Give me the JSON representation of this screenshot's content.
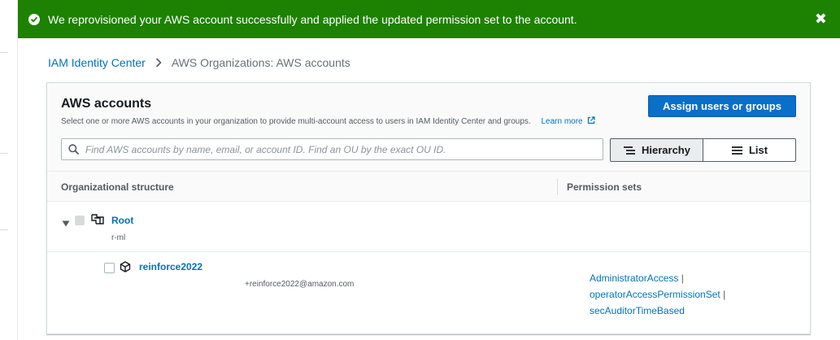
{
  "flash": {
    "message": "We reprovisioned your AWS account successfully and applied the updated permission set to the account.",
    "close": "✖",
    "color": "#1d8102"
  },
  "breadcrumb": {
    "items": [
      {
        "label": "IAM Identity Center"
      },
      {
        "label": "AWS Organizations: AWS accounts"
      }
    ]
  },
  "panel": {
    "title": "AWS accounts",
    "description": "Select one or more AWS accounts in your organization to provide multi-account access to users in IAM Identity Center and groups.",
    "learn_more": "Learn more",
    "assign_button": "Assign users or groups",
    "search": {
      "placeholder": "Find AWS accounts by name, email, or account ID. Find an OU by the exact OU ID.",
      "value": ""
    },
    "view_toggle": {
      "hierarchy": "Hierarchy",
      "list": "List",
      "selected": "Hierarchy"
    },
    "columns": {
      "structure": "Organizational structure",
      "permission_sets": "Permission sets"
    },
    "root": {
      "name": "Root",
      "id": "r-ml"
    },
    "accounts": [
      {
        "name": "reinforce2022",
        "email": "+reinforce2022@amazon.com",
        "permission_sets": [
          "AdministratorAccess",
          "operatorAccessPermissionSet",
          "secAuditorTimeBased"
        ],
        "separator": "|"
      }
    ]
  },
  "colors": {
    "primary": "#0a6fc9",
    "link": "#0073bb",
    "success": "#1d8102"
  }
}
